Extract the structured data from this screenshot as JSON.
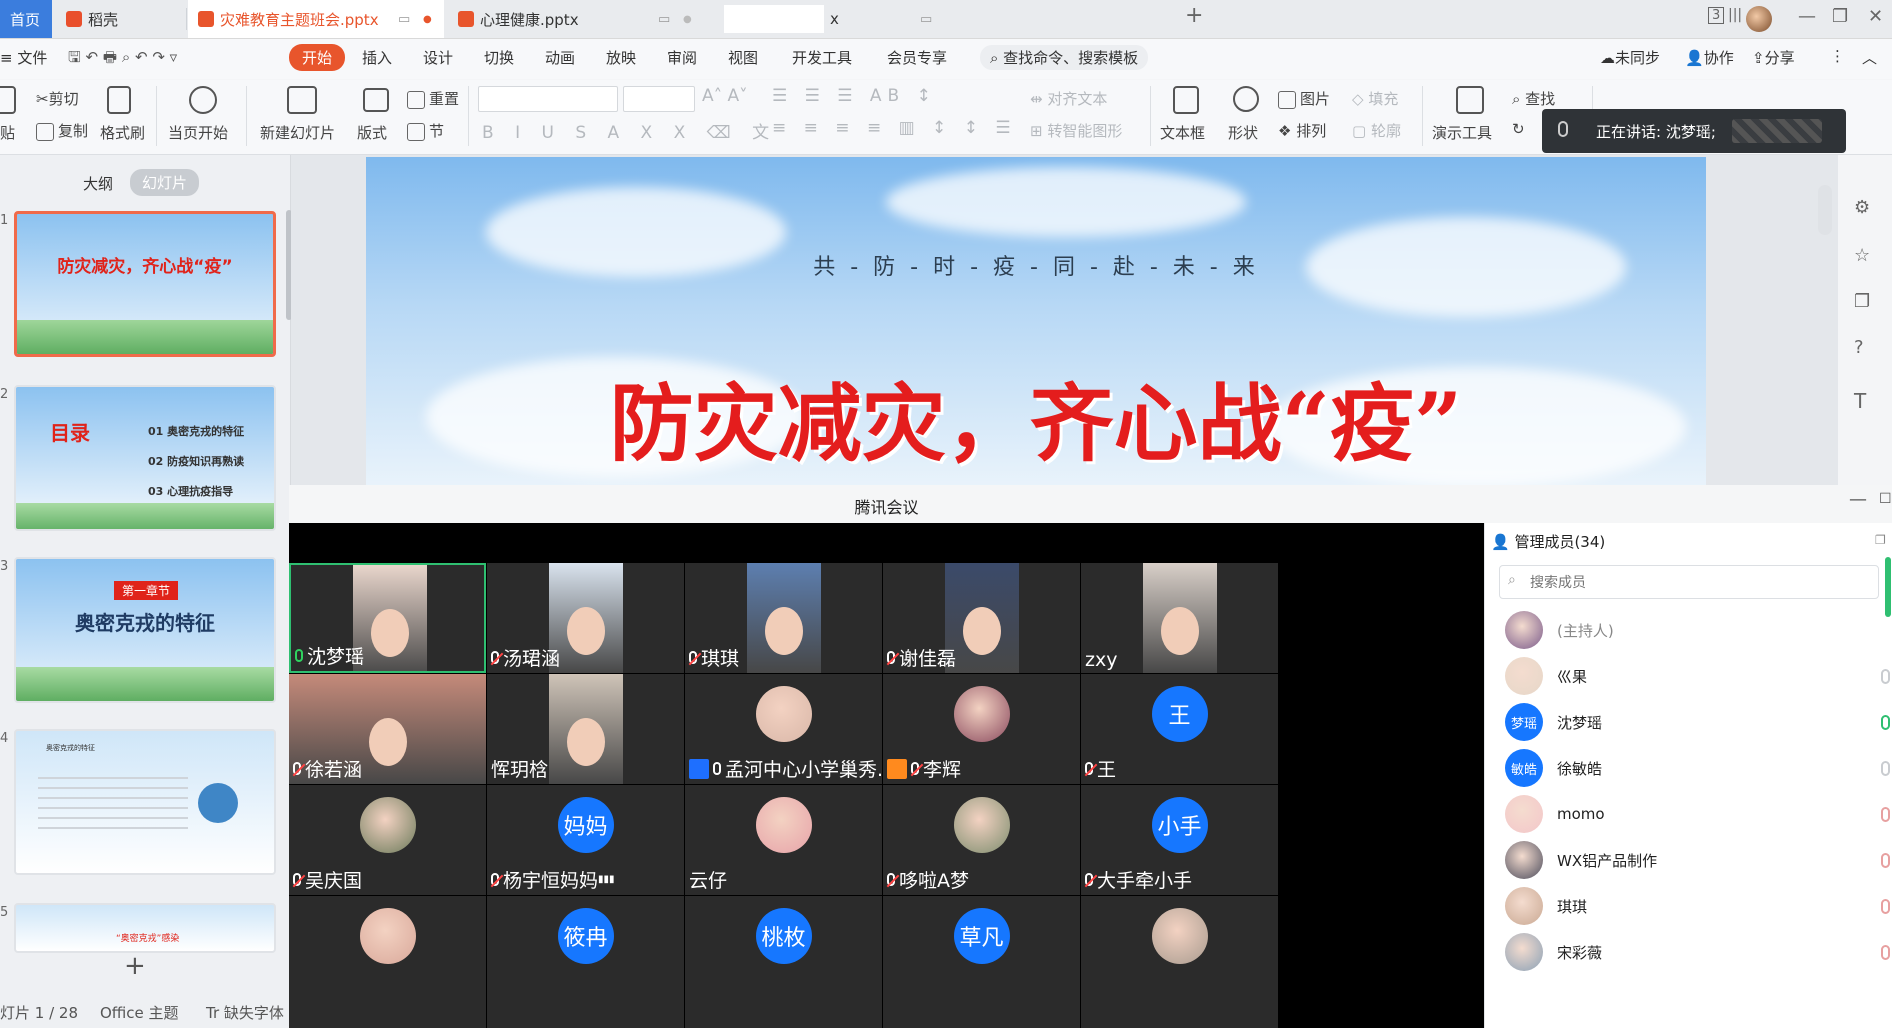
{
  "tabs": [
    {
      "label": "首页",
      "type": "home"
    },
    {
      "label": "稻壳",
      "type": "normal",
      "color": "#e94f2c"
    },
    {
      "label": "灾难教育主题班会.pptx",
      "type": "active",
      "color": "#e8552c"
    },
    {
      "label": "心理健康.pptx",
      "type": "normal",
      "color": "#e8552c"
    },
    {
      "label": "x",
      "type": "normal"
    }
  ],
  "window": {
    "badge": "3"
  },
  "menu": {
    "file": "文件",
    "items": [
      "开始",
      "插入",
      "设计",
      "切换",
      "动画",
      "放映",
      "审阅",
      "视图",
      "开发工具",
      "会员专享"
    ],
    "active": "开始",
    "search": "查找命令、搜索模板",
    "sync": "未同步",
    "collab": "协作",
    "share": "分享"
  },
  "ribbon": {
    "paste": "贴",
    "cut": "剪切",
    "copy": "复制",
    "format_brush": "格式刷",
    "from_current": "当页开始",
    "new_slide": "新建幻灯片",
    "layout": "版式",
    "reset": "重置",
    "section": "节",
    "align_text": "对齐文本",
    "smart_convert": "转智能图形",
    "textbox": "文本框",
    "shape": "形状",
    "picture": "图片",
    "arrange": "排列",
    "fill": "填充",
    "outline": "轮廓",
    "presenter": "演示工具",
    "find": "查找"
  },
  "speaking": {
    "text": "正在讲话: 沈梦瑶;"
  },
  "left_panel": {
    "tab_outline": "大纲",
    "tab_slides": "幻灯片",
    "thumbs": [
      {
        "num": "1",
        "title": "防灾减灾，齐心战“疫”"
      },
      {
        "num": "2",
        "title": "目录",
        "items": [
          "01 奥密克戎的特征",
          "02 防疫知识再熟读",
          "03 心理抗疫指导"
        ]
      },
      {
        "num": "3",
        "title": "第一章节",
        "subtitle": "奥密克戎的特征"
      },
      {
        "num": "4",
        "title": "奥密克戎的特征"
      },
      {
        "num": "5",
        "title": "“奥密克戎”感染"
      }
    ]
  },
  "slide": {
    "subtitle": "共 - 防 - 时 - 疫 - 同 - 赴 - 未 - 来",
    "title": "防灾减灾，齐心战“疫”"
  },
  "status": {
    "slide": "灯片 1 / 28",
    "theme": "Office 主题",
    "font": "缺失字体"
  },
  "meeting": {
    "title": "腾讯会议",
    "tiles": [
      {
        "name": "沈梦瑶",
        "mic": "on",
        "video": true,
        "active": true,
        "bg": "#e9d6cc"
      },
      {
        "name": "汤珺涵",
        "mic": "muted",
        "video": true,
        "bg": "#d9e3ee"
      },
      {
        "name": "琪琪",
        "mic": "muted",
        "video": true,
        "bg": "#5d7fb0"
      },
      {
        "name": "谢佳磊",
        "mic": "muted",
        "video": true,
        "bg": "#3b4a6a"
      },
      {
        "name": "zxy",
        "mic": "none",
        "video": true,
        "bg": "#d8cfc8"
      },
      {
        "name": "徐若涵",
        "mic": "muted",
        "video": true,
        "bg": "#c58a7a",
        "wide": true
      },
      {
        "name": "恽玥梒",
        "mic": "none",
        "video": true,
        "bg": "#cfc4b8"
      },
      {
        "name": "孟河中心小学巢秀...",
        "mic": "on_white",
        "video": false,
        "avatar": "photo",
        "tag": "#1e6fff",
        "bg": "#d9b7a8"
      },
      {
        "name": "李辉",
        "mic": "muted",
        "video": false,
        "avatar": "photo",
        "tag": "#ff8a1e",
        "bg": "#8a4a5e"
      },
      {
        "name": "王",
        "mic": "muted",
        "video": false,
        "avatar": "text",
        "avatar_text": "王",
        "bg": "#1677ff"
      },
      {
        "name": "吴庆国",
        "mic": "muted",
        "video": false,
        "avatar": "photo",
        "bg": "#6b7a5a"
      },
      {
        "name": "杨宇恒妈妈",
        "mic": "muted",
        "video": false,
        "avatar": "text",
        "avatar_text": "妈妈",
        "bg": "#1677ff",
        "signal": true
      },
      {
        "name": "云仔",
        "mic": "none",
        "video": false,
        "avatar": "photo",
        "bg": "#e7a3a9"
      },
      {
        "name": "哆啦A梦",
        "mic": "muted",
        "video": false,
        "avatar": "photo",
        "bg": "#7d8d6e"
      },
      {
        "name": "大手牵小手",
        "mic": "muted",
        "video": false,
        "avatar": "text",
        "avatar_text": "小手",
        "bg": "#1677ff"
      },
      {
        "name": "",
        "mic": "none",
        "video": false,
        "avatar": "photo",
        "bg": "#d9a89a"
      },
      {
        "name": "",
        "mic": "none",
        "video": false,
        "avatar": "text",
        "avatar_text": "筱冉",
        "bg": "#1677ff"
      },
      {
        "name": "",
        "mic": "none",
        "video": false,
        "avatar": "text",
        "avatar_text": "桃枚",
        "bg": "#1677ff"
      },
      {
        "name": "",
        "mic": "none",
        "video": false,
        "avatar": "text",
        "avatar_text": "草凡",
        "bg": "#1677ff"
      },
      {
        "name": "",
        "mic": "none",
        "video": false,
        "avatar": "photo",
        "bg": "#a89b8f"
      }
    ],
    "members_header": "管理成员(34)",
    "search_placeholder": "搜索成员",
    "members": [
      {
        "name": "(主持人)",
        "avatar": "photo",
        "bg": "#7a5a8a",
        "host": true
      },
      {
        "name": "巛果",
        "avatar": "photo",
        "bg": "#e6d7c8",
        "mic": "grey"
      },
      {
        "name": "沈梦瑶",
        "avatar": "text",
        "avatar_text": "梦瑶",
        "bg": "#1677ff",
        "mic": "green"
      },
      {
        "name": "徐敏皓",
        "avatar": "text",
        "avatar_text": "敏皓",
        "bg": "#1677ff",
        "mic": "grey"
      },
      {
        "name": "momo",
        "avatar": "photo",
        "bg": "#f3c6c9",
        "mic": "muted"
      },
      {
        "name": "WX铝产品制作",
        "avatar": "photo",
        "bg": "#4a4a5a",
        "mic": "muted"
      },
      {
        "name": "琪琪",
        "avatar": "photo",
        "bg": "#c9a892",
        "mic": "muted"
      },
      {
        "name": "宋彩薇",
        "avatar": "photo",
        "bg": "#8aa0b5",
        "mic": "muted"
      }
    ]
  }
}
